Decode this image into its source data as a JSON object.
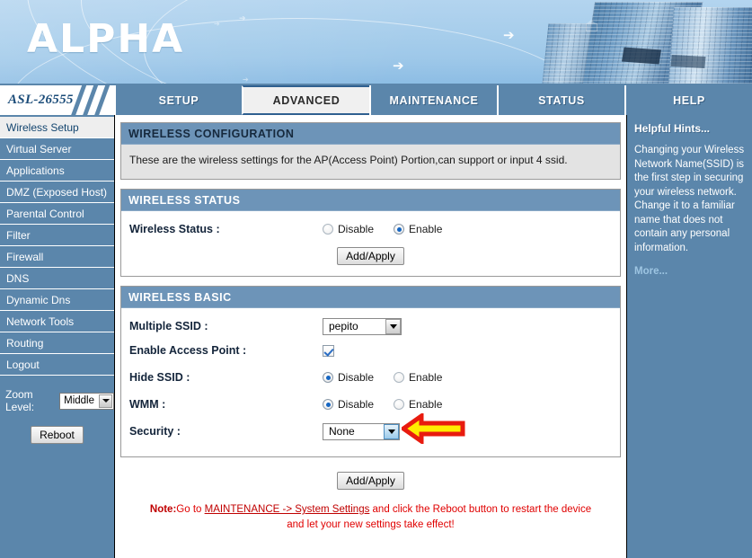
{
  "header": {
    "logo_text": "ALPHA",
    "model_badge": "ASL-26555"
  },
  "tabs": [
    {
      "label": "SETUP",
      "active": false
    },
    {
      "label": "ADVANCED",
      "active": true
    },
    {
      "label": "MAINTENANCE",
      "active": false
    },
    {
      "label": "STATUS",
      "active": false
    },
    {
      "label": "HELP",
      "active": false
    }
  ],
  "sidebar": {
    "items": [
      {
        "label": "Wireless Setup",
        "active": true
      },
      {
        "label": "Virtual Server",
        "active": false
      },
      {
        "label": "Applications",
        "active": false
      },
      {
        "label": "DMZ (Exposed Host)",
        "active": false
      },
      {
        "label": "Parental Control",
        "active": false
      },
      {
        "label": "Filter",
        "active": false
      },
      {
        "label": "Firewall",
        "active": false
      },
      {
        "label": "DNS",
        "active": false
      },
      {
        "label": "Dynamic Dns",
        "active": false
      },
      {
        "label": "Network Tools",
        "active": false
      },
      {
        "label": "Routing",
        "active": false
      },
      {
        "label": "Logout",
        "active": false
      }
    ],
    "zoom_label": "Zoom Level:",
    "zoom_value": "Middle",
    "reboot_label": "Reboot"
  },
  "config_panel": {
    "title": "WIRELESS CONFIGURATION",
    "description": "These are the wireless settings for the AP(Access Point) Portion,can support or input 4 ssid."
  },
  "status_panel": {
    "title": "WIRELESS STATUS",
    "row_label": "Wireless Status :",
    "option_disable": "Disable",
    "option_enable": "Enable",
    "selected": "Enable",
    "apply_label": "Add/Apply"
  },
  "basic_panel": {
    "title": "WIRELESS BASIC",
    "multiple_ssid_label": "Multiple SSID :",
    "multiple_ssid_value": "pepito",
    "enable_ap_label": "Enable Access Point :",
    "enable_ap_checked": true,
    "hide_ssid_label": "Hide SSID :",
    "hide_ssid_selected": "Disable",
    "wmm_label": "WMM :",
    "wmm_selected": "Disable",
    "option_disable": "Disable",
    "option_enable": "Enable",
    "security_label": "Security :",
    "security_value": "None"
  },
  "footer": {
    "apply_label": "Add/Apply",
    "note_prefix": "Note:",
    "note_text_1": "Go to ",
    "note_link": "MAINTENANCE -> System Settings",
    "note_text_2": " and click the Reboot button to restart the device and let your new settings take effect!"
  },
  "hints": {
    "title": "Helpful Hints...",
    "body": "Changing your Wireless Network Name(SSID) is the first step in securing your wireless network. Change it to a familiar name that does not contain any personal information.",
    "more_label": "More..."
  },
  "annotation": {
    "arrow_fill": "#ffec00",
    "arrow_stroke": "#e81b0f",
    "points_at": "security-dropdown"
  },
  "colors": {
    "panel_header": "#6d94b8",
    "chrome_blue": "#5b86ab",
    "note_red": "#e00000"
  }
}
